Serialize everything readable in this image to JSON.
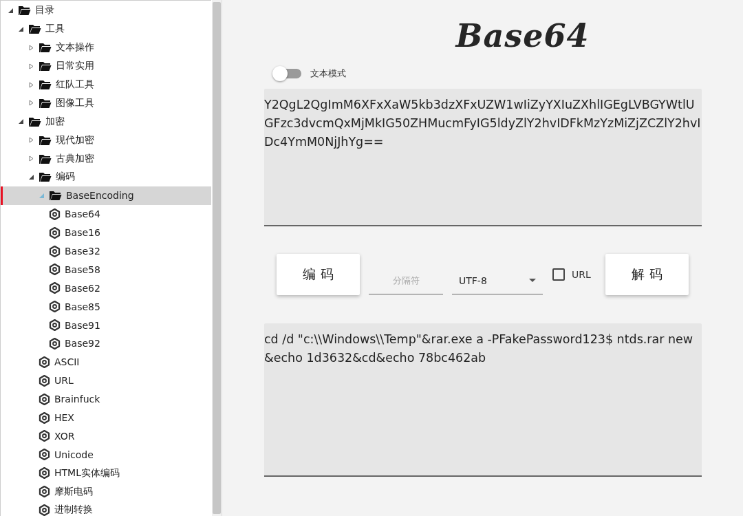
{
  "tree": [
    {
      "label": "目录",
      "kind": "folder",
      "expanded": true,
      "selected": false,
      "children": [
        {
          "label": "工具",
          "kind": "folder",
          "expanded": true,
          "selected": false,
          "children": [
            {
              "label": "文本操作",
              "kind": "folder",
              "expanded": false,
              "selected": false
            },
            {
              "label": "日常实用",
              "kind": "folder",
              "expanded": false,
              "selected": false
            },
            {
              "label": "红队工具",
              "kind": "folder",
              "expanded": false,
              "selected": false
            },
            {
              "label": "图像工具",
              "kind": "folder",
              "expanded": false,
              "selected": false
            }
          ]
        },
        {
          "label": "加密",
          "kind": "folder",
          "expanded": true,
          "selected": false,
          "children": [
            {
              "label": "现代加密",
              "kind": "folder",
              "expanded": false,
              "selected": false
            },
            {
              "label": "古典加密",
              "kind": "folder",
              "expanded": false,
              "selected": false
            },
            {
              "label": "编码",
              "kind": "folder",
              "expanded": true,
              "selected": false,
              "children": [
                {
                  "label": "BaseEncoding",
                  "kind": "folder",
                  "expanded": true,
                  "selected": true,
                  "children": [
                    {
                      "label": "Base64",
                      "kind": "tool",
                      "selected": false
                    },
                    {
                      "label": "Base16",
                      "kind": "tool",
                      "selected": false
                    },
                    {
                      "label": "Base32",
                      "kind": "tool",
                      "selected": false
                    },
                    {
                      "label": "Base58",
                      "kind": "tool",
                      "selected": false
                    },
                    {
                      "label": "Base62",
                      "kind": "tool",
                      "selected": false
                    },
                    {
                      "label": "Base85",
                      "kind": "tool",
                      "selected": false
                    },
                    {
                      "label": "Base91",
                      "kind": "tool",
                      "selected": false
                    },
                    {
                      "label": "Base92",
                      "kind": "tool",
                      "selected": false
                    }
                  ]
                },
                {
                  "label": "ASCII",
                  "kind": "tool",
                  "selected": false
                },
                {
                  "label": "URL",
                  "kind": "tool",
                  "selected": false
                },
                {
                  "label": "Brainfuck",
                  "kind": "tool",
                  "selected": false
                },
                {
                  "label": "HEX",
                  "kind": "tool",
                  "selected": false
                },
                {
                  "label": "XOR",
                  "kind": "tool",
                  "selected": false
                },
                {
                  "label": "Unicode",
                  "kind": "tool",
                  "selected": false
                },
                {
                  "label": "HTML实体编码",
                  "kind": "tool",
                  "selected": false
                },
                {
                  "label": "摩斯电码",
                  "kind": "tool",
                  "selected": false
                },
                {
                  "label": "进制转换",
                  "kind": "tool",
                  "selected": false
                }
              ]
            }
          ]
        }
      ]
    }
  ],
  "logo_title": "Base64",
  "text_mode_toggle": {
    "label": "文本模式",
    "on": false
  },
  "input": {
    "value": "Y2QgL2QgImM6XFxXaW5kb3dzXFxUZW1wIiZyYXIuZXhlIGEgLVBGYWtlUGFzc3dvcmQxMjMkIG50ZHMucmFyIG5ldyZlY2hvIDFkMzYzMiZjZCZlY2hvIDc4YmM0NjJhYg=="
  },
  "encode_button": "编 码",
  "separator_field": {
    "placeholder": "分隔符"
  },
  "encoding_select": {
    "value": "UTF-8"
  },
  "url_checkbox": {
    "label": "URL",
    "checked": false
  },
  "decode_button": "解 码",
  "output": {
    "value": "cd /d \"c:\\\\Windows\\\\Temp\"&rar.exe a -PFakePassword123$ ntds.rar new&echo 1d3632&cd&echo 78bc462ab"
  }
}
